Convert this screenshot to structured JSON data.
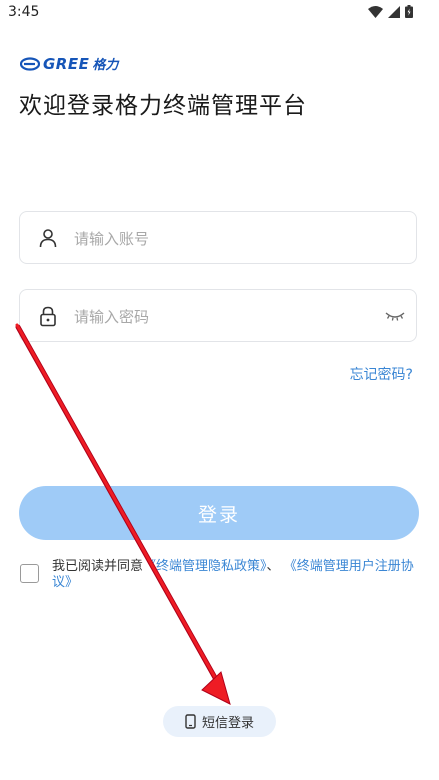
{
  "status_bar": {
    "time": "3:45",
    "icons": [
      "wifi-icon",
      "signal-icon",
      "battery-icon"
    ]
  },
  "brand": {
    "logo_text": "GREE",
    "logo_cn": "格力",
    "color": "#1655b8"
  },
  "title": "欢迎登录格力终端管理平台",
  "account": {
    "placeholder": "请输入账号",
    "value": "",
    "icon": "user-icon"
  },
  "password": {
    "placeholder": "请输入密码",
    "value": "",
    "icon": "lock-icon",
    "toggle_icon": "eye-closed-icon"
  },
  "forgot_password": "忘记密码?",
  "login_button": "登录",
  "agreement": {
    "prefix": "我已阅读并同意",
    "privacy_link": "《终端管理隐私政策》",
    "separator": "、",
    "user_link": "《终端管理用户注册协议》",
    "checked": false
  },
  "sms_login": {
    "label": "短信登录",
    "icon": "phone-icon"
  },
  "colors": {
    "accent": "#3a86d4",
    "button_disabled": "#9fcbf7",
    "annotation_arrow": "#e8141c"
  }
}
